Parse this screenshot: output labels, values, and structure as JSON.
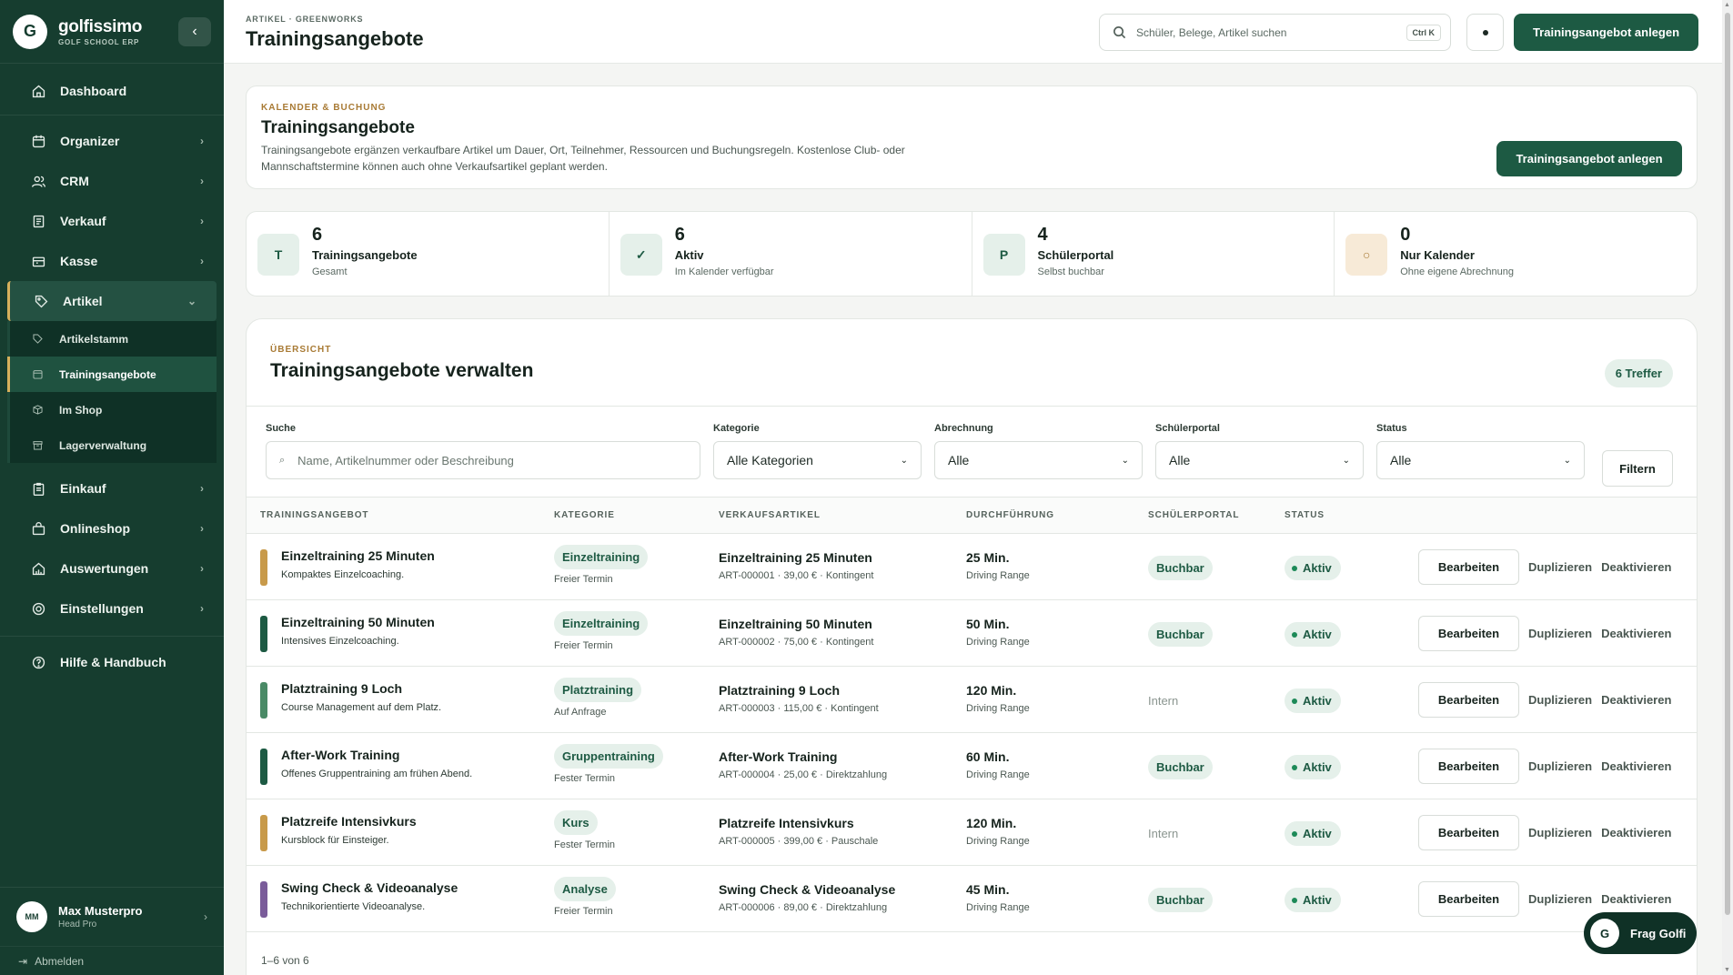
{
  "brand": {
    "logo_letter": "G",
    "name": "golfissimo",
    "subtitle": "GOLF SCHOOL ERP"
  },
  "sidebar": {
    "items": [
      {
        "label": "Dashboard",
        "icon": "home-icon"
      },
      {
        "label": "Organizer",
        "icon": "calendar-icon"
      },
      {
        "label": "CRM",
        "icon": "users-icon"
      },
      {
        "label": "Verkauf",
        "icon": "receipt-icon"
      },
      {
        "label": "Kasse",
        "icon": "register-icon"
      },
      {
        "label": "Artikel",
        "icon": "tag-icon"
      },
      {
        "label": "Einkauf",
        "icon": "clipboard-icon"
      },
      {
        "label": "Onlineshop",
        "icon": "bag-icon"
      },
      {
        "label": "Auswertungen",
        "icon": "chart-icon"
      },
      {
        "label": "Einstellungen",
        "icon": "gear-icon"
      },
      {
        "label": "Hilfe & Handbuch",
        "icon": "help-icon"
      }
    ],
    "sub_items": [
      {
        "label": "Artikelstamm"
      },
      {
        "label": "Trainingsangebote"
      },
      {
        "label": "Im Shop"
      },
      {
        "label": "Lagerverwaltung"
      }
    ],
    "user": {
      "initials": "MM",
      "name": "Max Musterpro",
      "role": "Head Pro"
    },
    "logout": "Abmelden"
  },
  "topbar": {
    "breadcrumb": "ARTIKEL · GREENWORKS",
    "title": "Trainingsangebote",
    "search_placeholder": "Schüler, Belege, Artikel suchen",
    "shortcut": "Ctrl K",
    "cta": "Trainingsangebot anlegen"
  },
  "hero": {
    "eyebrow": "KALENDER & BUCHUNG",
    "title": "Trainingsangebote",
    "description": "Trainingsangebote ergänzen verkaufbare Artikel um Dauer, Ort, Teilnehmer, Ressourcen und Buchungsregeln. Kostenlose Club- oder Mannschaftstermine können auch ohne Verkaufsartikel geplant werden.",
    "cta": "Trainingsangebot anlegen"
  },
  "stats": [
    {
      "icon": "T",
      "value": "6",
      "label": "Trainingsangebote",
      "sub": "Gesamt"
    },
    {
      "icon": "✓",
      "value": "6",
      "label": "Aktiv",
      "sub": "Im Kalender verfügbar"
    },
    {
      "icon": "P",
      "value": "4",
      "label": "Schülerportal",
      "sub": "Selbst buchbar"
    },
    {
      "icon": "○",
      "value": "0",
      "label": "Nur Kalender",
      "sub": "Ohne eigene Abrechnung"
    }
  ],
  "panel": {
    "eyebrow": "ÜBERSICHT",
    "title": "Trainingsangebote verwalten",
    "hits": "6 Treffer",
    "filters": {
      "search_label": "Suche",
      "search_placeholder": "Name, Artikelnummer oder Beschreibung",
      "category_label": "Kategorie",
      "category_value": "Alle Kategorien",
      "billing_label": "Abrechnung",
      "billing_value": "Alle",
      "portal_label": "Schülerportal",
      "portal_value": "Alle",
      "status_label": "Status",
      "status_value": "Alle",
      "filter_button": "Filtern"
    },
    "columns": [
      "TRAININGSANGEBOT",
      "KATEGORIE",
      "VERKAUFSARTIKEL",
      "DURCHFÜHRUNG",
      "SCHÜLERPORTAL",
      "STATUS"
    ],
    "rows": [
      {
        "color": "#c89a4a",
        "name": "Einzeltraining 25 Minuten",
        "desc": "Kompaktes Einzelcoaching.",
        "category": "Einzeltraining",
        "mode": "Freier Termin",
        "article": "Einzeltraining 25 Minuten",
        "article_meta": "ART-000001 · 39,00 € · Kontingent",
        "duration": "25 Min.",
        "place": "Driving Range",
        "portal": "Buchbar",
        "status": "Aktiv"
      },
      {
        "color": "#1d5a43",
        "name": "Einzeltraining 50 Minuten",
        "desc": "Intensives Einzelcoaching.",
        "category": "Einzeltraining",
        "mode": "Freier Termin",
        "article": "Einzeltraining 50 Minuten",
        "article_meta": "ART-000002 · 75,00 € · Kontingent",
        "duration": "50 Min.",
        "place": "Driving Range",
        "portal": "Buchbar",
        "status": "Aktiv"
      },
      {
        "color": "#4a8a66",
        "name": "Platztraining 9 Loch",
        "desc": "Course Management auf dem Platz.",
        "category": "Platztraining",
        "mode": "Auf Anfrage",
        "article": "Platztraining 9 Loch",
        "article_meta": "ART-000003 · 115,00 € · Kontingent",
        "duration": "120 Min.",
        "place": "Driving Range",
        "portal": "Intern",
        "status": "Aktiv"
      },
      {
        "color": "#1d5a43",
        "name": "After-Work Training",
        "desc": "Offenes Gruppentraining am frühen Abend.",
        "category": "Gruppentraining",
        "mode": "Fester Termin",
        "article": "After-Work Training",
        "article_meta": "ART-000004 · 25,00 € · Direktzahlung",
        "duration": "60 Min.",
        "place": "Driving Range",
        "portal": "Buchbar",
        "status": "Aktiv"
      },
      {
        "color": "#c89a4a",
        "name": "Platzreife Intensivkurs",
        "desc": "Kursblock für Einsteiger.",
        "category": "Kurs",
        "mode": "Fester Termin",
        "article": "Platzreife Intensivkurs",
        "article_meta": "ART-000005 · 399,00 € · Pauschale",
        "duration": "120 Min.",
        "place": "Driving Range",
        "portal": "Intern",
        "status": "Aktiv"
      },
      {
        "color": "#7a5c9a",
        "name": "Swing Check & Videoanalyse",
        "desc": "Technikorientierte Videoanalyse.",
        "category": "Analyse",
        "mode": "Freier Termin",
        "article": "Swing Check & Videoanalyse",
        "article_meta": "ART-000006 · 89,00 € · Direktzahlung",
        "duration": "45 Min.",
        "place": "Driving Range",
        "portal": "Buchbar",
        "status": "Aktiv"
      }
    ],
    "actions": {
      "edit": "Bearbeiten",
      "duplicate": "Duplizieren",
      "deactivate": "Deaktivieren"
    },
    "count": "1–6 von 6"
  },
  "chat": {
    "letter": "G",
    "label": "Frag Golfi"
  }
}
